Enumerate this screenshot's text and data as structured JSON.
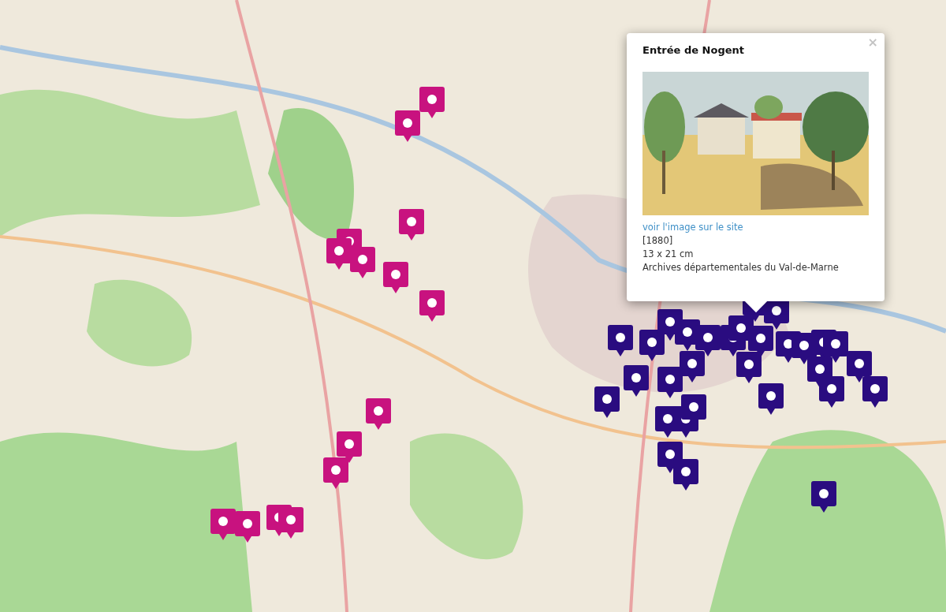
{
  "markers": [
    {
      "color": "#c8127f"
    },
    {
      "color": "#c8127f"
    },
    {
      "color": "#c8127f"
    },
    {
      "color": "#c8127f"
    },
    {
      "color": "#c8127f"
    },
    {
      "color": "#c8127f"
    },
    {
      "color": "#c8127f"
    },
    {
      "color": "#c8127f"
    },
    {
      "color": "#c8127f"
    },
    {
      "color": "#c8127f"
    },
    {
      "color": "#c8127f"
    },
    {
      "color": "#c8127f"
    },
    {
      "color": "#c8127f"
    },
    {
      "color": "#c8127f"
    },
    {
      "color": "#c8127f"
    },
    {
      "color": "#2a0c80"
    },
    {
      "color": "#2a0c80"
    },
    {
      "color": "#2a0c80"
    },
    {
      "color": "#2a0c80"
    },
    {
      "color": "#2a0c80"
    },
    {
      "color": "#2a0c80"
    },
    {
      "color": "#2a0c80"
    },
    {
      "color": "#2a0c80"
    },
    {
      "color": "#2a0c80"
    },
    {
      "color": "#2a0c80"
    },
    {
      "color": "#2a0c80"
    },
    {
      "color": "#2a0c80"
    },
    {
      "color": "#2a0c80"
    },
    {
      "color": "#2a0c80"
    },
    {
      "color": "#2a0c80"
    },
    {
      "color": "#2a0c80"
    },
    {
      "color": "#2a0c80"
    },
    {
      "color": "#2a0c80"
    },
    {
      "color": "#2a0c80"
    },
    {
      "color": "#2a0c80"
    },
    {
      "color": "#2a0c80"
    },
    {
      "color": "#2a0c80"
    },
    {
      "color": "#2a0c80"
    },
    {
      "color": "#2a0c80"
    },
    {
      "color": "#2a0c80"
    },
    {
      "color": "#2a0c80"
    },
    {
      "color": "#2a0c80"
    },
    {
      "color": "#2a0c80"
    },
    {
      "color": "#2a0c80"
    },
    {
      "color": "#2a0c80"
    }
  ],
  "popup": {
    "title": "Entrée de Nogent",
    "link": "voir l'image sur le site",
    "date": "[1880]",
    "dimensions": "13 x 21 cm",
    "source": "Archives départementales du Val-de-Marne",
    "close": "×"
  }
}
